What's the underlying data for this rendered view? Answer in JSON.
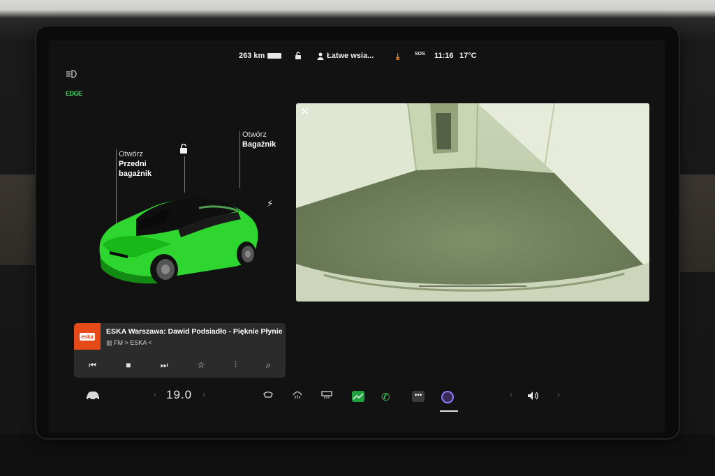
{
  "status_bar": {
    "range": "263 km",
    "profile": "Łatwe wsia...",
    "sos": "SOS",
    "time": "11:16",
    "temperature": "17°C"
  },
  "left_panel": {
    "edge_label": "EDGE"
  },
  "car": {
    "front_trunk_label_line1": "Otwórz",
    "front_trunk_label_line2": "Przedni",
    "front_trunk_label_line3": "bagażnik",
    "trunk_label_line1": "Otwórz",
    "trunk_label_line2": "Bagażnik",
    "body_color": "#2fd62f"
  },
  "camera": {
    "close_label": "✕"
  },
  "media": {
    "logo_text": "eska",
    "now_playing": "ESKA Warszawa: Dawid Podsiadło - Pięknie Płynie",
    "source": "FM > ESKA <"
  },
  "bottom_bar": {
    "cabin_temp": "19.0"
  },
  "colors": {
    "accent_green": "#3fd35c",
    "download_orange": "#ff8a1c",
    "eska_red": "#e64a19"
  }
}
